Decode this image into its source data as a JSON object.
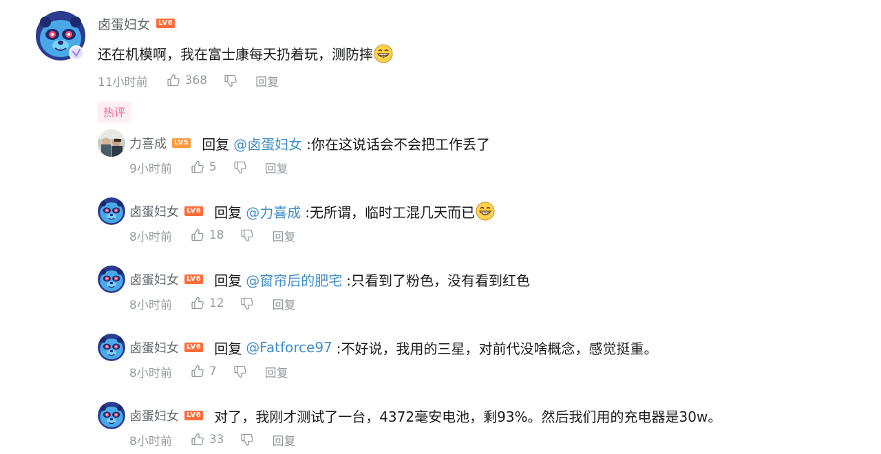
{
  "main_comment": {
    "username": "卤蛋妇女",
    "level": "LV6",
    "text": "还在机模啊，我在富士康每天扔着玩，测防摔",
    "emoji": "grin-emoji",
    "time": "11小时前",
    "likes": "368",
    "reply_label": "回复",
    "badge": "热评"
  },
  "replies": [
    {
      "username": "力喜成",
      "level": "LV5",
      "reply_word": "回复",
      "at": "@卤蛋妇女",
      "text": ":你在这说话会不会把工作丢了",
      "time": "9小时前",
      "likes": "5",
      "reply_label": "回复"
    },
    {
      "username": "卤蛋妇女",
      "level": "LV6",
      "reply_word": "回复",
      "at": "@力喜成",
      "text": ":无所谓，临时工混几天而已",
      "time": "8小时前",
      "likes": "18",
      "reply_label": "回复"
    },
    {
      "username": "卤蛋妇女",
      "level": "LV6",
      "reply_word": "回复",
      "at": "@窗帘后的肥宅",
      "text": ":只看到了粉色，没有看到红色",
      "time": "8小时前",
      "likes": "12",
      "reply_label": "回复"
    },
    {
      "username": "卤蛋妇女",
      "level": "LV6",
      "reply_word": "回复",
      "at": "@Fatforce97",
      "text": ":不好说，我用的三星，对前代没啥概念，感觉挺重。",
      "time": "8小时前",
      "likes": "7",
      "reply_label": "回复"
    },
    {
      "username": "卤蛋妇女",
      "level": "LV6",
      "text": "对了，我刚才测试了一台，4372毫安电池，剩93%。然后我们用的充电器是30w。",
      "time": "8小时前",
      "likes": "33",
      "reply_label": "回复"
    }
  ],
  "colors": {
    "link": "#3f8ec9",
    "meta": "#9499a0",
    "badge_bg": "#ffeef2",
    "badge_text": "#ff6699",
    "level_lv6": "#ff6d3a",
    "level_lv5": "#ff9a3d"
  }
}
